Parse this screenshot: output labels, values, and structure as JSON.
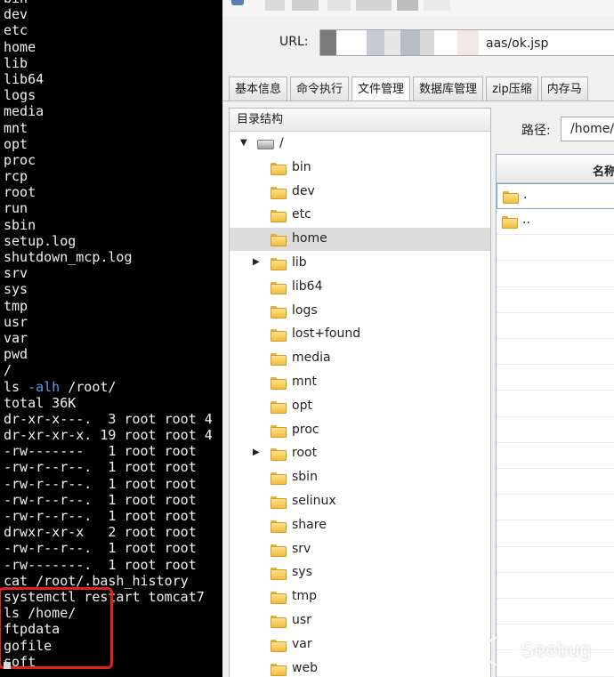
{
  "terminal": {
    "lines": [
      {
        "text": "bin"
      },
      {
        "text": "dev"
      },
      {
        "text": "etc"
      },
      {
        "text": "home"
      },
      {
        "text": "lib"
      },
      {
        "text": "lib64"
      },
      {
        "text": "logs"
      },
      {
        "text": "media"
      },
      {
        "text": "mnt"
      },
      {
        "text": "opt"
      },
      {
        "text": "proc"
      },
      {
        "text": "rcp"
      },
      {
        "text": "root"
      },
      {
        "text": "run"
      },
      {
        "text": "sbin"
      },
      {
        "text": "setup.log"
      },
      {
        "text": "shutdown_mcp.log"
      },
      {
        "text": "srv"
      },
      {
        "text": "sys"
      },
      {
        "text": "tmp"
      },
      {
        "text": "usr"
      },
      {
        "text": "var"
      },
      {
        "text": "pwd"
      },
      {
        "text": "/"
      },
      {
        "cmd": "ls ",
        "flag": "-alh",
        "rest": " /root/"
      },
      {
        "text": "total 36K"
      },
      {
        "text": "dr-xr-x---.  3 root root 4"
      },
      {
        "text": "dr-xr-xr-x. 19 root root 4"
      },
      {
        "text": "-rw-------   1 root root"
      },
      {
        "text": "-rw-r--r--.  1 root root"
      },
      {
        "text": "-rw-r--r--.  1 root root"
      },
      {
        "text": "-rw-r--r--.  1 root root"
      },
      {
        "text": "-rw-r--r--.  1 root root"
      },
      {
        "text": "drwxr-xr-x   2 root root"
      },
      {
        "text": "-rw-r--r--.  1 root root"
      },
      {
        "text": "-rw-------.  1 root root"
      },
      {
        "text": "cat /root/.bash_history"
      },
      {
        "text": "systemctl restart tomcat7"
      },
      {
        "text": "ls /home/"
      },
      {
        "text": "ftpdata"
      },
      {
        "text": "gofile"
      },
      {
        "text": "soft"
      }
    ]
  },
  "toolbar": {
    "url_label": "URL:",
    "url_value": "aas/ok.jsp"
  },
  "tabs": [
    {
      "label": "基本信息",
      "active": false
    },
    {
      "label": "命令执行",
      "active": false
    },
    {
      "label": "文件管理",
      "active": true
    },
    {
      "label": "数据库管理",
      "active": false
    },
    {
      "label": "zip压缩",
      "active": false
    },
    {
      "label": "内存马",
      "active": false
    }
  ],
  "tree": {
    "header": "目录结构",
    "root_label": "/",
    "items": [
      {
        "label": "bin",
        "expandable": false,
        "selected": false
      },
      {
        "label": "dev",
        "expandable": false,
        "selected": false
      },
      {
        "label": "etc",
        "expandable": false,
        "selected": false
      },
      {
        "label": "home",
        "expandable": false,
        "selected": true
      },
      {
        "label": "lib",
        "expandable": true,
        "selected": false
      },
      {
        "label": "lib64",
        "expandable": false,
        "selected": false
      },
      {
        "label": "logs",
        "expandable": false,
        "selected": false
      },
      {
        "label": "lost+found",
        "expandable": false,
        "selected": false
      },
      {
        "label": "media",
        "expandable": false,
        "selected": false
      },
      {
        "label": "mnt",
        "expandable": false,
        "selected": false
      },
      {
        "label": "opt",
        "expandable": false,
        "selected": false
      },
      {
        "label": "proc",
        "expandable": false,
        "selected": false
      },
      {
        "label": "root",
        "expandable": true,
        "selected": false
      },
      {
        "label": "sbin",
        "expandable": false,
        "selected": false
      },
      {
        "label": "selinux",
        "expandable": false,
        "selected": false
      },
      {
        "label": "share",
        "expandable": false,
        "selected": false
      },
      {
        "label": "srv",
        "expandable": false,
        "selected": false
      },
      {
        "label": "sys",
        "expandable": false,
        "selected": false
      },
      {
        "label": "tmp",
        "expandable": false,
        "selected": false
      },
      {
        "label": "usr",
        "expandable": false,
        "selected": false
      },
      {
        "label": "var",
        "expandable": false,
        "selected": false
      },
      {
        "label": "web",
        "expandable": false,
        "selected": false
      }
    ]
  },
  "file_panel": {
    "path_label": "路径:",
    "path_value": "/home/",
    "column_name": "名称",
    "rows": [
      {
        "name": "."
      },
      {
        "name": ".."
      }
    ]
  },
  "watermark": {
    "text": "Seebug"
  },
  "colors": {
    "highlight": "#e0241c",
    "flag": "#5f9ee8",
    "selection": "#dcdcdc"
  }
}
